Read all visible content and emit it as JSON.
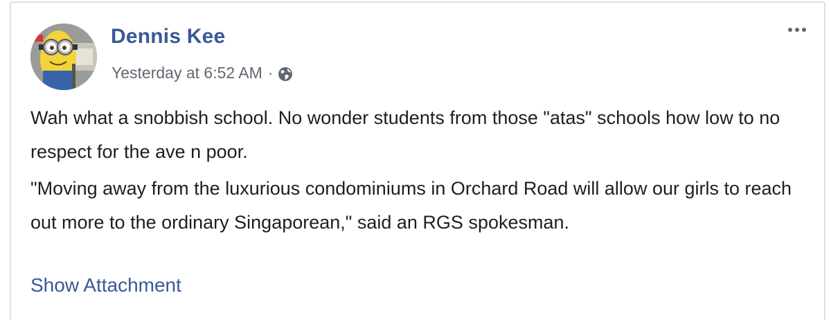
{
  "post": {
    "author": "Dennis Kee",
    "timestamp": "Yesterday at 6:52 AM",
    "separator": "·",
    "privacy_icon": "globe-icon",
    "menu_icon": "more-options-icon",
    "avatar_icon": "minion-avatar",
    "paragraphs": [
      "Wah what a snobbish school. No wonder students from those \"atas\" schools how low to no respect for the ave n poor.",
      "\"Moving away from the luxurious condominiums in Orchard Road will allow our girls to reach out more to the ordinary Singaporean,\" said an RGS spokesman."
    ],
    "show_attachment_label": "Show Attachment"
  },
  "colors": {
    "link": "#385898",
    "meta": "#616770",
    "text": "#1c1e21",
    "border": "#dddfe2"
  }
}
